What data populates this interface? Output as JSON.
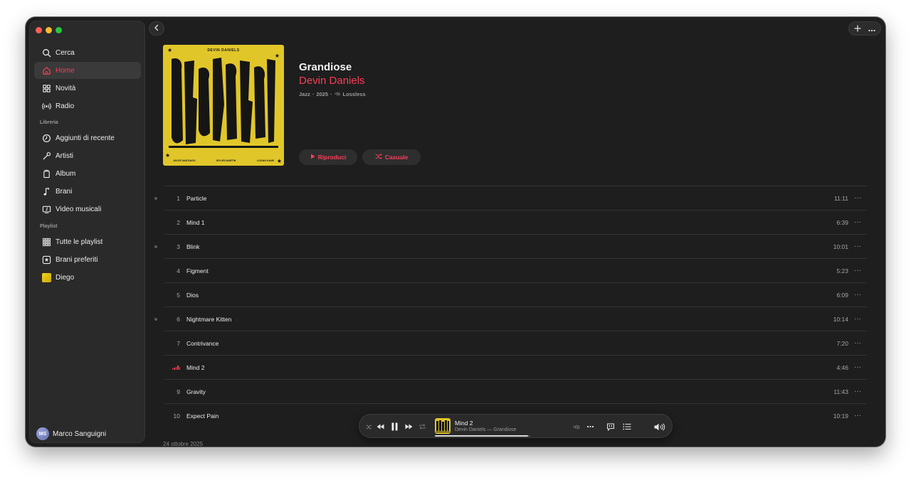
{
  "sidebar": {
    "nav": [
      {
        "label": "Cerca",
        "icon": "search-icon"
      },
      {
        "label": "Home",
        "icon": "home-icon",
        "active": true
      },
      {
        "label": "Novità",
        "icon": "grid-icon"
      },
      {
        "label": "Radio",
        "icon": "radio-icon"
      }
    ],
    "library_title": "Libreria",
    "library": [
      {
        "label": "Aggiunti di recente",
        "icon": "clock-icon"
      },
      {
        "label": "Artisti",
        "icon": "microphone-icon"
      },
      {
        "label": "Album",
        "icon": "album-icon"
      },
      {
        "label": "Brani",
        "icon": "music-note-icon"
      },
      {
        "label": "Video musicali",
        "icon": "video-icon"
      }
    ],
    "playlist_title": "Playlist",
    "playlists": [
      {
        "label": "Tutte le playlist",
        "icon": "playlists-grid-icon"
      },
      {
        "label": "Brani preferiti",
        "icon": "star-icon"
      },
      {
        "label": "Diego",
        "icon": "playlist-cover-icon"
      }
    ],
    "user": {
      "initials": "MS",
      "name": "Marco Sanguigni"
    }
  },
  "album": {
    "title": "Grandiose",
    "artist": "Devin Daniels",
    "genre": "Jazz",
    "year": "2025",
    "quality": "Lossless",
    "cover_top": "DEVIN DANIELS",
    "cover_word": "GRANDIOSE",
    "cover_credits": [
      "JAYCE SANTIAGO",
      "MYLES MARTIN",
      "LOGAN KANE"
    ],
    "play_label": "Riproduci",
    "shuffle_label": "Casuale",
    "release_date": "24 ottobre 2025"
  },
  "tracks": [
    {
      "num": "1",
      "title": "Particle",
      "duration": "11:11",
      "marker": true
    },
    {
      "num": "2",
      "title": "Mind 1",
      "duration": "6:39",
      "marker": false
    },
    {
      "num": "3",
      "title": "Blink",
      "duration": "10:01",
      "marker": true
    },
    {
      "num": "4",
      "title": "Figment",
      "duration": "5:23",
      "marker": false
    },
    {
      "num": "5",
      "title": "Dios",
      "duration": "6:09",
      "marker": false
    },
    {
      "num": "6",
      "title": "Nightmare Kitten",
      "duration": "10:14",
      "marker": true
    },
    {
      "num": "7",
      "title": "Contrivance",
      "duration": "7:20",
      "marker": false
    },
    {
      "num": "",
      "title": "Mind 2",
      "duration": "4:46",
      "marker": false,
      "playing": true
    },
    {
      "num": "9",
      "title": "Gravity",
      "duration": "11:43",
      "marker": false
    },
    {
      "num": "10",
      "title": "Expect Pain",
      "duration": "10:19",
      "marker": false
    }
  ],
  "player": {
    "title": "Mind 2",
    "subtitle": "Devin Daniels — Grandiose",
    "progress": 0.98
  },
  "colors": {
    "accent": "#fa3d58",
    "cover": "#e1c62a"
  }
}
